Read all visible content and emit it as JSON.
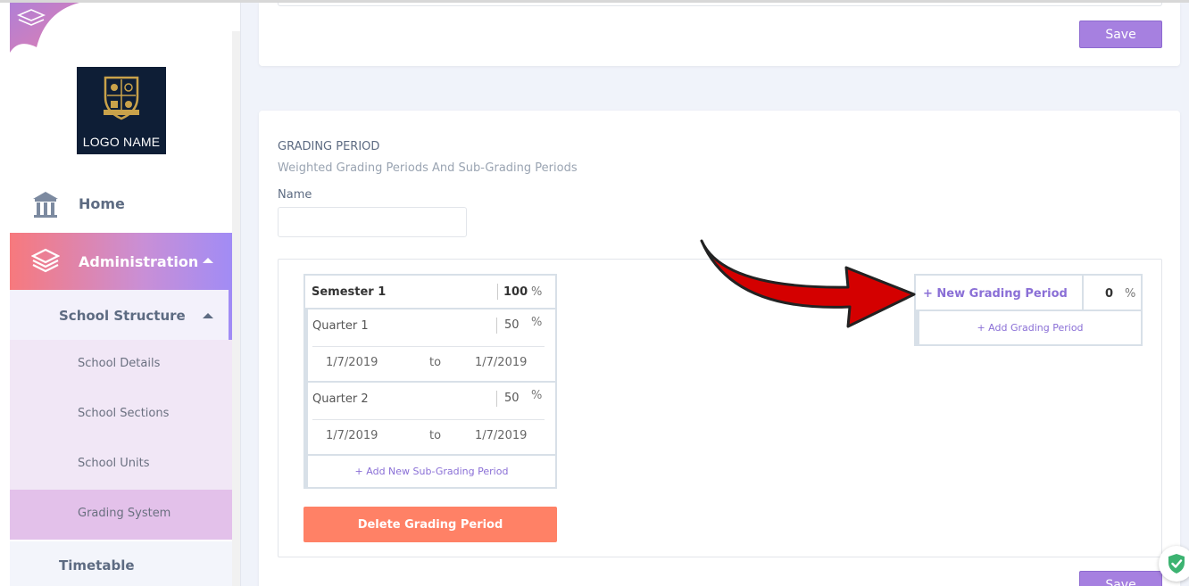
{
  "sidebar": {
    "logo_text": "LOGO NAME",
    "home_label": "Home",
    "admin_label": "Administration",
    "school_structure_label": "School Structure",
    "sub_items": [
      {
        "label": "School Details"
      },
      {
        "label": "School Sections"
      },
      {
        "label": "School Units"
      },
      {
        "label": "Grading System"
      }
    ],
    "timetable_label": "Timetable"
  },
  "top_card": {
    "save_label": "Save"
  },
  "grading_period": {
    "title": "GRADING PERIOD",
    "subtitle": "Weighted Grading Periods And Sub-Grading Periods",
    "name_label": "Name",
    "name_value": "",
    "semester": {
      "name": "Semester 1",
      "weight": "100",
      "pct": "%",
      "quarters": [
        {
          "name": "Quarter 1",
          "weight": "50",
          "pct": "%",
          "start": "1/7/2019",
          "to": "to",
          "end": "1/7/2019"
        },
        {
          "name": "Quarter 2",
          "weight": "50",
          "pct": "%",
          "start": "1/7/2019",
          "to": "to",
          "end": "1/7/2019"
        }
      ],
      "add_sub_label": "+ Add New Sub-Grading Period"
    },
    "delete_label": "Delete Grading Period",
    "new_period": {
      "name": "+ New Grading Period",
      "weight": "0",
      "pct": "%",
      "add_label": "+ Add Grading Period"
    },
    "save_label": "Save"
  },
  "colors": {
    "accent_purple": "#a680e0",
    "delete_orange": "#ff8166",
    "arrow_red": "#d40000"
  }
}
